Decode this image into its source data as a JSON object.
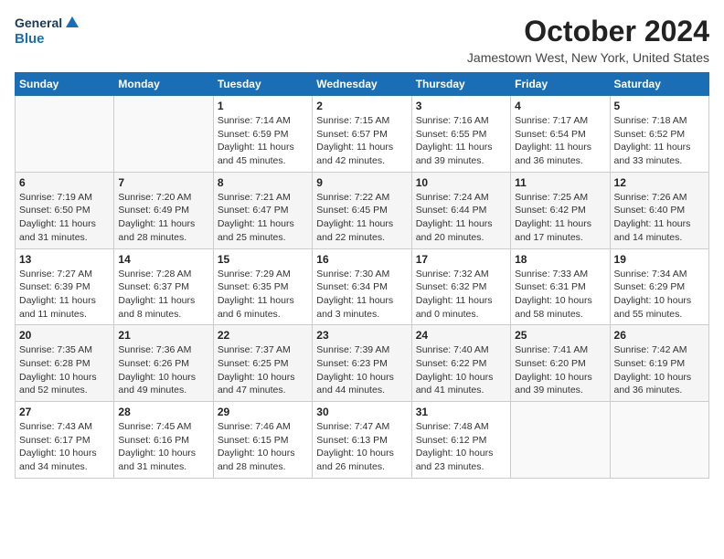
{
  "logo": {
    "line1": "General",
    "line2": "Blue"
  },
  "title": "October 2024",
  "location": "Jamestown West, New York, United States",
  "weekdays": [
    "Sunday",
    "Monday",
    "Tuesday",
    "Wednesday",
    "Thursday",
    "Friday",
    "Saturday"
  ],
  "weeks": [
    [
      {
        "day": "",
        "info": ""
      },
      {
        "day": "",
        "info": ""
      },
      {
        "day": "1",
        "info": "Sunrise: 7:14 AM\nSunset: 6:59 PM\nDaylight: 11 hours and 45 minutes."
      },
      {
        "day": "2",
        "info": "Sunrise: 7:15 AM\nSunset: 6:57 PM\nDaylight: 11 hours and 42 minutes."
      },
      {
        "day": "3",
        "info": "Sunrise: 7:16 AM\nSunset: 6:55 PM\nDaylight: 11 hours and 39 minutes."
      },
      {
        "day": "4",
        "info": "Sunrise: 7:17 AM\nSunset: 6:54 PM\nDaylight: 11 hours and 36 minutes."
      },
      {
        "day": "5",
        "info": "Sunrise: 7:18 AM\nSunset: 6:52 PM\nDaylight: 11 hours and 33 minutes."
      }
    ],
    [
      {
        "day": "6",
        "info": "Sunrise: 7:19 AM\nSunset: 6:50 PM\nDaylight: 11 hours and 31 minutes."
      },
      {
        "day": "7",
        "info": "Sunrise: 7:20 AM\nSunset: 6:49 PM\nDaylight: 11 hours and 28 minutes."
      },
      {
        "day": "8",
        "info": "Sunrise: 7:21 AM\nSunset: 6:47 PM\nDaylight: 11 hours and 25 minutes."
      },
      {
        "day": "9",
        "info": "Sunrise: 7:22 AM\nSunset: 6:45 PM\nDaylight: 11 hours and 22 minutes."
      },
      {
        "day": "10",
        "info": "Sunrise: 7:24 AM\nSunset: 6:44 PM\nDaylight: 11 hours and 20 minutes."
      },
      {
        "day": "11",
        "info": "Sunrise: 7:25 AM\nSunset: 6:42 PM\nDaylight: 11 hours and 17 minutes."
      },
      {
        "day": "12",
        "info": "Sunrise: 7:26 AM\nSunset: 6:40 PM\nDaylight: 11 hours and 14 minutes."
      }
    ],
    [
      {
        "day": "13",
        "info": "Sunrise: 7:27 AM\nSunset: 6:39 PM\nDaylight: 11 hours and 11 minutes."
      },
      {
        "day": "14",
        "info": "Sunrise: 7:28 AM\nSunset: 6:37 PM\nDaylight: 11 hours and 8 minutes."
      },
      {
        "day": "15",
        "info": "Sunrise: 7:29 AM\nSunset: 6:35 PM\nDaylight: 11 hours and 6 minutes."
      },
      {
        "day": "16",
        "info": "Sunrise: 7:30 AM\nSunset: 6:34 PM\nDaylight: 11 hours and 3 minutes."
      },
      {
        "day": "17",
        "info": "Sunrise: 7:32 AM\nSunset: 6:32 PM\nDaylight: 11 hours and 0 minutes."
      },
      {
        "day": "18",
        "info": "Sunrise: 7:33 AM\nSunset: 6:31 PM\nDaylight: 10 hours and 58 minutes."
      },
      {
        "day": "19",
        "info": "Sunrise: 7:34 AM\nSunset: 6:29 PM\nDaylight: 10 hours and 55 minutes."
      }
    ],
    [
      {
        "day": "20",
        "info": "Sunrise: 7:35 AM\nSunset: 6:28 PM\nDaylight: 10 hours and 52 minutes."
      },
      {
        "day": "21",
        "info": "Sunrise: 7:36 AM\nSunset: 6:26 PM\nDaylight: 10 hours and 49 minutes."
      },
      {
        "day": "22",
        "info": "Sunrise: 7:37 AM\nSunset: 6:25 PM\nDaylight: 10 hours and 47 minutes."
      },
      {
        "day": "23",
        "info": "Sunrise: 7:39 AM\nSunset: 6:23 PM\nDaylight: 10 hours and 44 minutes."
      },
      {
        "day": "24",
        "info": "Sunrise: 7:40 AM\nSunset: 6:22 PM\nDaylight: 10 hours and 41 minutes."
      },
      {
        "day": "25",
        "info": "Sunrise: 7:41 AM\nSunset: 6:20 PM\nDaylight: 10 hours and 39 minutes."
      },
      {
        "day": "26",
        "info": "Sunrise: 7:42 AM\nSunset: 6:19 PM\nDaylight: 10 hours and 36 minutes."
      }
    ],
    [
      {
        "day": "27",
        "info": "Sunrise: 7:43 AM\nSunset: 6:17 PM\nDaylight: 10 hours and 34 minutes."
      },
      {
        "day": "28",
        "info": "Sunrise: 7:45 AM\nSunset: 6:16 PM\nDaylight: 10 hours and 31 minutes."
      },
      {
        "day": "29",
        "info": "Sunrise: 7:46 AM\nSunset: 6:15 PM\nDaylight: 10 hours and 28 minutes."
      },
      {
        "day": "30",
        "info": "Sunrise: 7:47 AM\nSunset: 6:13 PM\nDaylight: 10 hours and 26 minutes."
      },
      {
        "day": "31",
        "info": "Sunrise: 7:48 AM\nSunset: 6:12 PM\nDaylight: 10 hours and 23 minutes."
      },
      {
        "day": "",
        "info": ""
      },
      {
        "day": "",
        "info": ""
      }
    ]
  ]
}
